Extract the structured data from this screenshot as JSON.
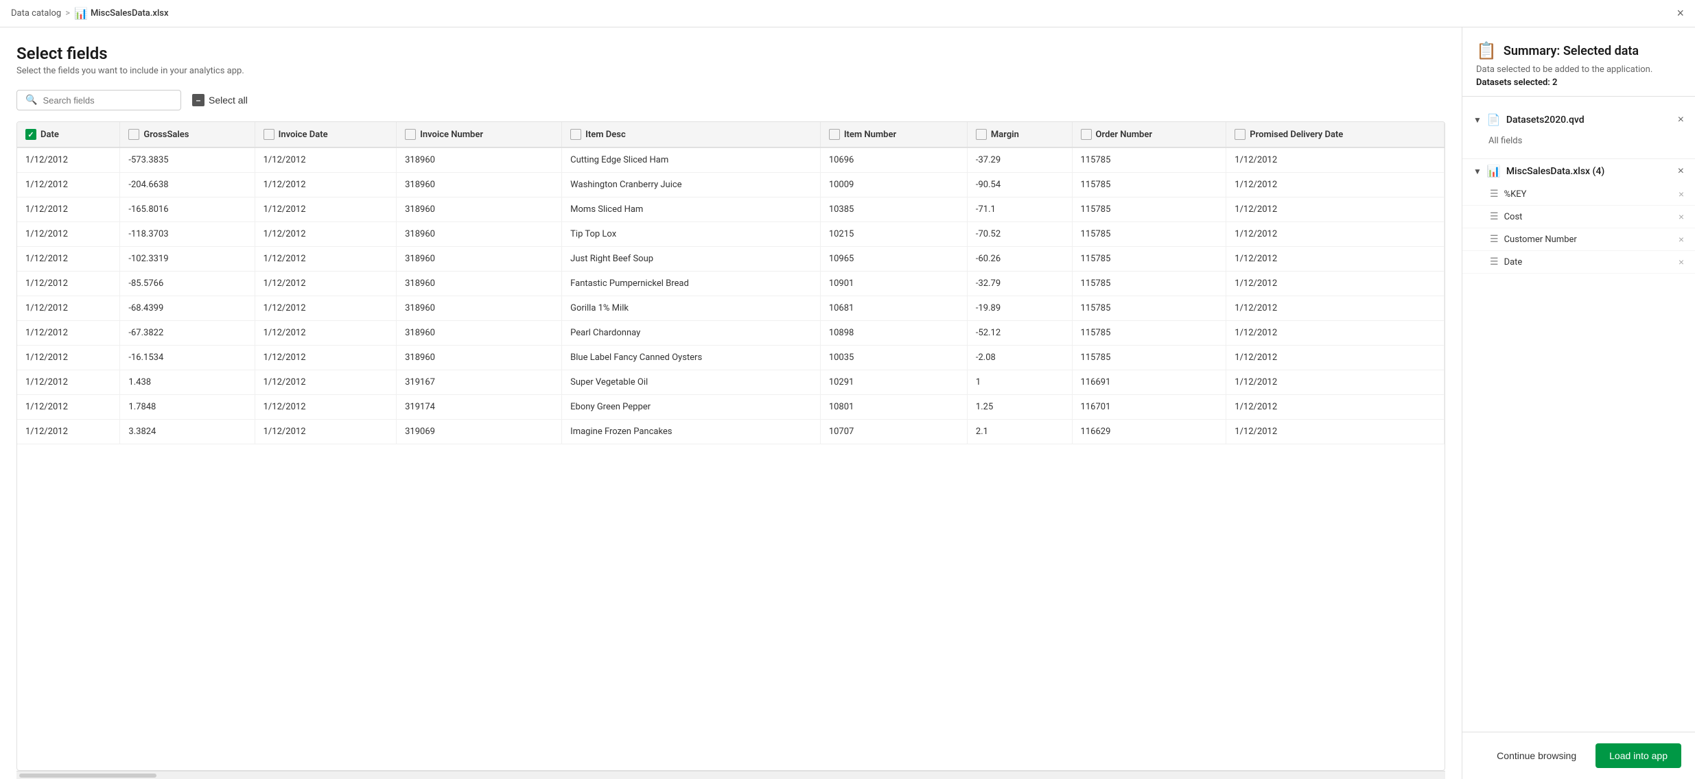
{
  "topbar": {
    "breadcrumb_home": "Data catalog",
    "breadcrumb_sep": ">",
    "breadcrumb_current": "MiscSalesData.xlsx",
    "close_label": "×"
  },
  "page": {
    "title": "Select fields",
    "subtitle": "Select the fields you want to include in your analytics app."
  },
  "toolbar": {
    "search_placeholder": "Search fields",
    "select_all_label": "Select all"
  },
  "table": {
    "columns": [
      {
        "id": "date",
        "label": "Date",
        "checked": true
      },
      {
        "id": "gross_sales",
        "label": "GrossSales",
        "checked": false
      },
      {
        "id": "invoice_date",
        "label": "Invoice Date",
        "checked": false
      },
      {
        "id": "invoice_number",
        "label": "Invoice Number",
        "checked": false
      },
      {
        "id": "item_desc",
        "label": "Item Desc",
        "checked": false
      },
      {
        "id": "item_number",
        "label": "Item Number",
        "checked": false
      },
      {
        "id": "margin",
        "label": "Margin",
        "checked": false
      },
      {
        "id": "order_number",
        "label": "Order Number",
        "checked": false
      },
      {
        "id": "promised_delivery_date",
        "label": "Promised Delivery Date",
        "checked": false
      }
    ],
    "rows": [
      {
        "date": "1/12/2012",
        "gross_sales": "-573.3835",
        "invoice_date": "1/12/2012",
        "invoice_number": "318960",
        "item_desc": "Cutting Edge Sliced Ham",
        "item_number": "10696",
        "margin": "-37.29",
        "order_number": "115785",
        "promised_delivery_date": "1/12/2012"
      },
      {
        "date": "1/12/2012",
        "gross_sales": "-204.6638",
        "invoice_date": "1/12/2012",
        "invoice_number": "318960",
        "item_desc": "Washington Cranberry Juice",
        "item_number": "10009",
        "margin": "-90.54",
        "order_number": "115785",
        "promised_delivery_date": "1/12/2012"
      },
      {
        "date": "1/12/2012",
        "gross_sales": "-165.8016",
        "invoice_date": "1/12/2012",
        "invoice_number": "318960",
        "item_desc": "Moms Sliced Ham",
        "item_number": "10385",
        "margin": "-71.1",
        "order_number": "115785",
        "promised_delivery_date": "1/12/2012"
      },
      {
        "date": "1/12/2012",
        "gross_sales": "-118.3703",
        "invoice_date": "1/12/2012",
        "invoice_number": "318960",
        "item_desc": "Tip Top Lox",
        "item_number": "10215",
        "margin": "-70.52",
        "order_number": "115785",
        "promised_delivery_date": "1/12/2012"
      },
      {
        "date": "1/12/2012",
        "gross_sales": "-102.3319",
        "invoice_date": "1/12/2012",
        "invoice_number": "318960",
        "item_desc": "Just Right Beef Soup",
        "item_number": "10965",
        "margin": "-60.26",
        "order_number": "115785",
        "promised_delivery_date": "1/12/2012"
      },
      {
        "date": "1/12/2012",
        "gross_sales": "-85.5766",
        "invoice_date": "1/12/2012",
        "invoice_number": "318960",
        "item_desc": "Fantastic Pumpernickel Bread",
        "item_number": "10901",
        "margin": "-32.79",
        "order_number": "115785",
        "promised_delivery_date": "1/12/2012"
      },
      {
        "date": "1/12/2012",
        "gross_sales": "-68.4399",
        "invoice_date": "1/12/2012",
        "invoice_number": "318960",
        "item_desc": "Gorilla 1% Milk",
        "item_number": "10681",
        "margin": "-19.89",
        "order_number": "115785",
        "promised_delivery_date": "1/12/2012"
      },
      {
        "date": "1/12/2012",
        "gross_sales": "-67.3822",
        "invoice_date": "1/12/2012",
        "invoice_number": "318960",
        "item_desc": "Pearl Chardonnay",
        "item_number": "10898",
        "margin": "-52.12",
        "order_number": "115785",
        "promised_delivery_date": "1/12/2012"
      },
      {
        "date": "1/12/2012",
        "gross_sales": "-16.1534",
        "invoice_date": "1/12/2012",
        "invoice_number": "318960",
        "item_desc": "Blue Label Fancy Canned Oysters",
        "item_number": "10035",
        "margin": "-2.08",
        "order_number": "115785",
        "promised_delivery_date": "1/12/2012"
      },
      {
        "date": "1/12/2012",
        "gross_sales": "1.438",
        "invoice_date": "1/12/2012",
        "invoice_number": "319167",
        "item_desc": "Super Vegetable Oil",
        "item_number": "10291",
        "margin": "1",
        "order_number": "116691",
        "promised_delivery_date": "1/12/2012"
      },
      {
        "date": "1/12/2012",
        "gross_sales": "1.7848",
        "invoice_date": "1/12/2012",
        "invoice_number": "319174",
        "item_desc": "Ebony Green Pepper",
        "item_number": "10801",
        "margin": "1.25",
        "order_number": "116701",
        "promised_delivery_date": "1/12/2012"
      },
      {
        "date": "1/12/2012",
        "gross_sales": "3.3824",
        "invoice_date": "1/12/2012",
        "invoice_number": "319069",
        "item_desc": "Imagine Frozen Pancakes",
        "item_number": "10707",
        "margin": "2.1",
        "order_number": "116629",
        "promised_delivery_date": "1/12/2012"
      }
    ]
  },
  "summary": {
    "title": "Summary: Selected data",
    "subtitle": "Data selected to be added to the application.",
    "datasets_label": "Datasets selected: 2",
    "dataset1": {
      "name": "Datasets2020.qvd",
      "all_fields_label": "All fields"
    },
    "dataset2": {
      "name": "MiscSalesData.xlsx (4)",
      "fields": [
        {
          "name": "%KEY"
        },
        {
          "name": "Cost"
        },
        {
          "name": "Customer Number"
        },
        {
          "name": "Date"
        }
      ]
    },
    "continue_label": "Continue browsing",
    "load_label": "Load into app"
  }
}
